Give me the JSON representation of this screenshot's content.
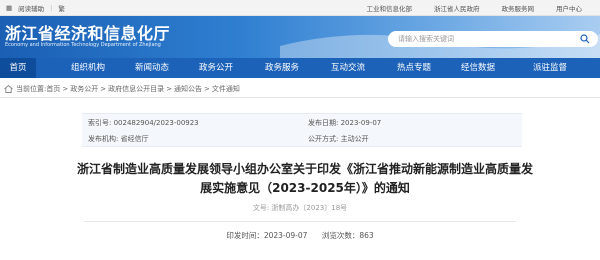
{
  "topbar": {
    "accessibility": "阅读辅助",
    "traditional": "繁",
    "links": [
      "工业和信息化部",
      "浙江省人民政府",
      "政务服务网",
      "用户中心"
    ]
  },
  "header": {
    "title": "浙江省经济和信息化厅",
    "subtitle": "Economy and Information Technology Department of Zhejiang",
    "search_placeholder": "请输入搜索关键词"
  },
  "nav": {
    "items": [
      "首页",
      "组织机构",
      "新闻动态",
      "政务公开",
      "政务服务",
      "互动交流",
      "热点专题",
      "经信数据",
      "派驻监督"
    ],
    "active": "首页"
  },
  "breadcrumb": {
    "prefix": "当前位置:",
    "items": [
      "首页",
      "政务公开",
      "政府信息公开目录",
      "通知公告",
      "文件通知"
    ]
  },
  "meta": {
    "index_no": "索引号: 002482904/2023-00923",
    "publish_date": "发布日期: 2023-09-07",
    "publisher": "发布机构: 省经信厅",
    "open_form": "公开方式: 主动公开"
  },
  "article": {
    "title_line1": "浙江省制造业高质量发展领导小组办公室关于印发《浙江省推动新能源制造业高质量发",
    "title_line2": "展实施意见（2023-2025年）》的通知",
    "doc_no": "文号: 浙制高办〔2023〕18号",
    "print_date": "印发时间：2023-09-07",
    "views": "浏览次数：863"
  },
  "colors": {
    "brand_blue": "#1c62b9",
    "nav_active": "#0e4d9c"
  }
}
